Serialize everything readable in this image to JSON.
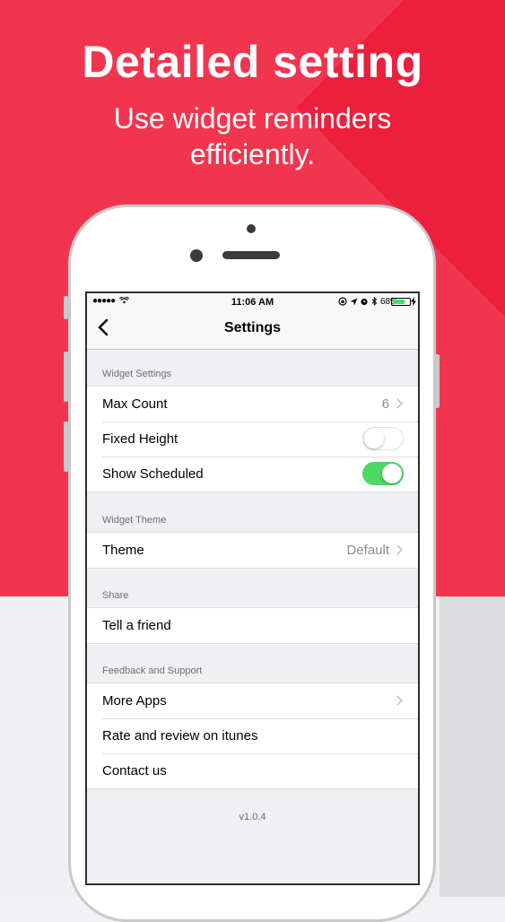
{
  "promo": {
    "headline": "Detailed setting",
    "subline_1": "Use widget reminders",
    "subline_2": "efficiently."
  },
  "status_bar": {
    "signal": "●●●●●",
    "time": "11:06 AM",
    "battery": "68%"
  },
  "nav": {
    "title": "Settings"
  },
  "sections": {
    "widget_settings": {
      "header": "Widget Settings",
      "max_count_label": "Max Count",
      "max_count_value": "6",
      "fixed_height_label": "Fixed Height",
      "show_scheduled_label": "Show Scheduled"
    },
    "widget_theme": {
      "header": "Widget Theme",
      "theme_label": "Theme",
      "theme_value": "Default"
    },
    "share": {
      "header": "Share",
      "tell_friend_label": "Tell a friend"
    },
    "feedback": {
      "header": "Feedback and Support",
      "more_apps_label": "More Apps",
      "rate_label": "Rate and review on itunes",
      "contact_label": "Contact us"
    }
  },
  "version": "v1.0.4",
  "colors": {
    "brand_red": "#f2354f",
    "toggle_on": "#4cd964"
  }
}
